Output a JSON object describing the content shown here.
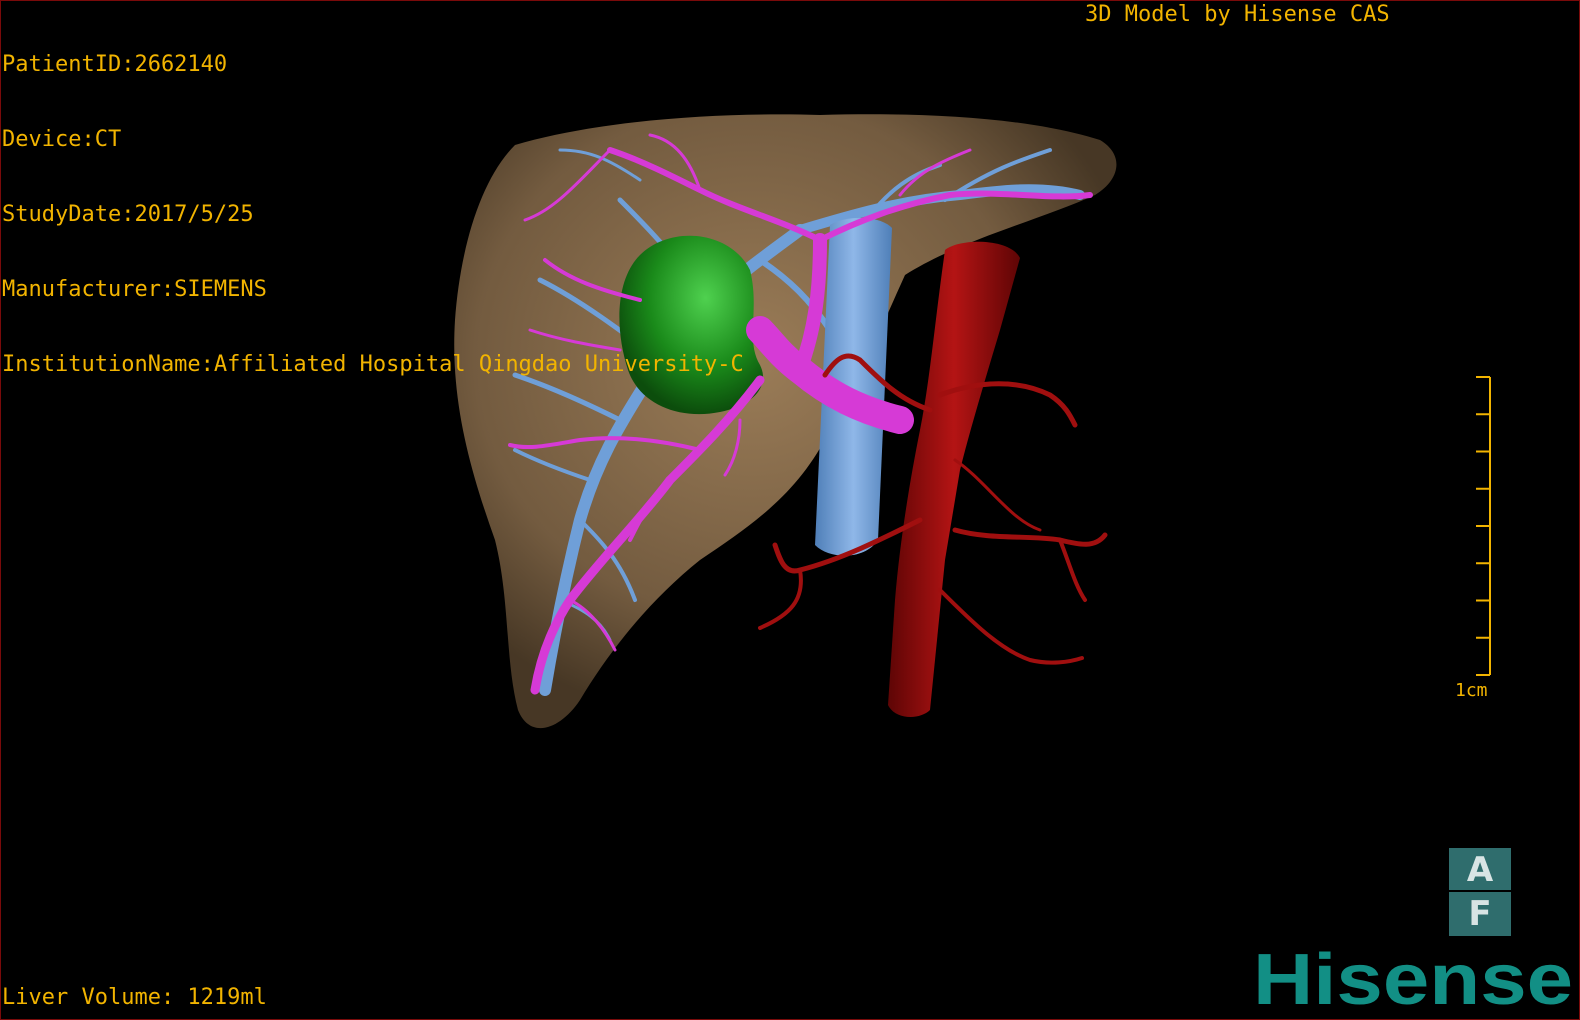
{
  "header": {
    "patient_id": "PatientID:2662140",
    "device": "Device:CT",
    "study_date": "StudyDate:2017/5/25",
    "manufacturer": "Manufacturer:SIEMENS",
    "institution": "InstitutionName:Affiliated Hospital Qingdao University-C"
  },
  "title": "3D Model by Hisense CAS",
  "footer": {
    "liver_volume": "Liver Volume: 1219ml"
  },
  "scale_bar": {
    "label": "1cm",
    "ticks": 9
  },
  "orientation": {
    "top": "A",
    "bottom": "F"
  },
  "logo": {
    "text": "Hisense"
  },
  "colors": {
    "overlay_text": "#f2b400",
    "liver": "#8b6e4e",
    "tumor": "#1f9a1f",
    "hepatic_vein": "#6f9fd8",
    "portal_vein": "#d63ad6",
    "artery": "#9e0e0e",
    "logo": "#128f85"
  },
  "model_parts": [
    "liver",
    "tumor",
    "portal-vein",
    "hepatic-vein",
    "inferior-vena-cava",
    "aorta",
    "arteries"
  ]
}
